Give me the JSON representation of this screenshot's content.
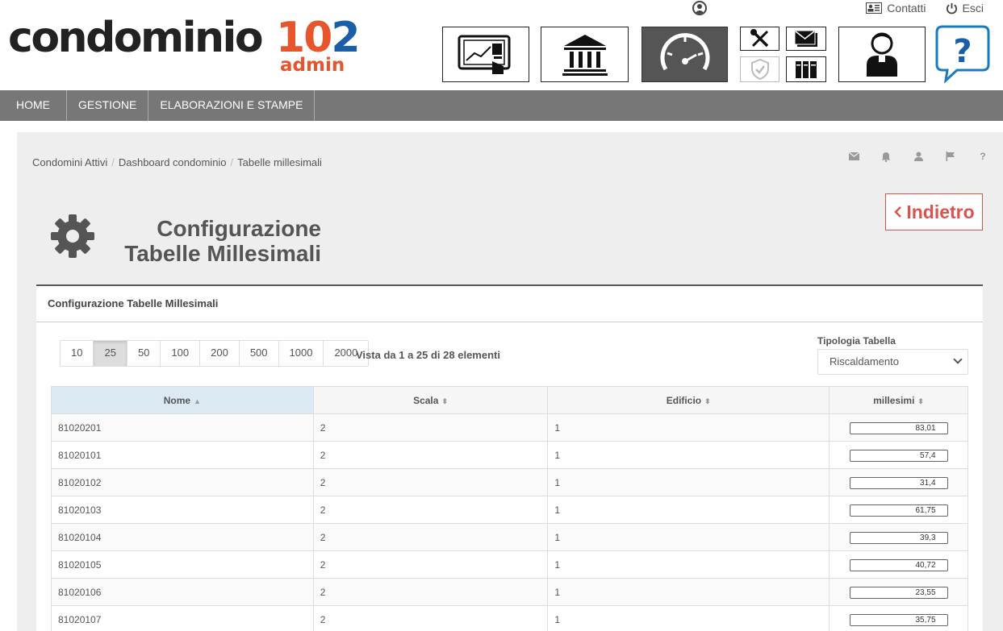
{
  "brand": {
    "name": "condominio",
    "num_a": "10",
    "num_b": "2",
    "sub": "admin"
  },
  "top_links": {
    "contact": "Contatti",
    "logout": "Esci"
  },
  "nav": [
    "HOME",
    "GESTIONE",
    "ELABORAZIONI E STAMPE"
  ],
  "breadcrumb": [
    "Condomini Attivi",
    "Dashboard condominio",
    "Tabelle millesimali"
  ],
  "page": {
    "title_line1": "Configurazione",
    "title_line2": "Tabelle Millesimali",
    "back_label": "Indietro"
  },
  "panel": {
    "heading": "Configurazione Tabelle Millesimali"
  },
  "pager": {
    "sizes": [
      "10",
      "25",
      "50",
      "100",
      "200",
      "500",
      "1000",
      "2000"
    ],
    "active": "25",
    "info": "Vista da 1 a 25 di 28 elementi"
  },
  "filter": {
    "label": "Tipologia Tabella",
    "value": "Riscaldamento"
  },
  "table": {
    "columns": [
      "Nome",
      "Scala",
      "Edificio",
      "millesimi"
    ],
    "rows": [
      [
        "81020201",
        "2",
        "1",
        "83,01"
      ],
      [
        "81020101",
        "2",
        "1",
        "57,4"
      ],
      [
        "81020102",
        "2",
        "1",
        "31,4"
      ],
      [
        "81020103",
        "2",
        "1",
        "61,75"
      ],
      [
        "81020104",
        "2",
        "1",
        "39,3"
      ],
      [
        "81020105",
        "2",
        "1",
        "40,72"
      ],
      [
        "81020106",
        "2",
        "1",
        "23,55"
      ],
      [
        "81020107",
        "2",
        "1",
        "35,75"
      ]
    ]
  },
  "colors": {
    "accent_orange": "#e8542b",
    "accent_blue": "#1a5ea8",
    "nav_bg": "#777777",
    "back_red": "#d9534f",
    "sorted_header": "#dbe9f3"
  }
}
